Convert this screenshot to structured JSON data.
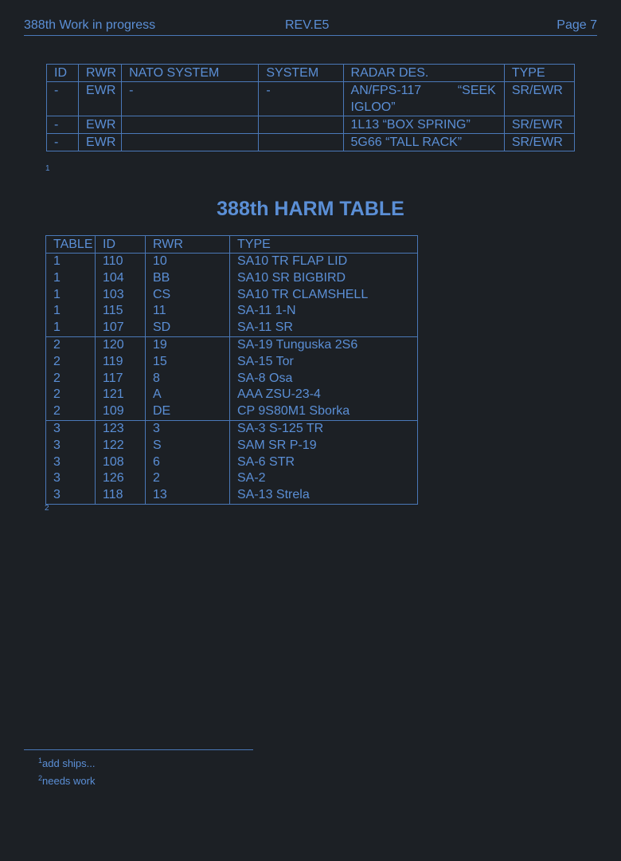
{
  "header": {
    "left": "388th Work in progress",
    "center": "REV.E5",
    "right": "Page 7"
  },
  "radar_table": {
    "headers": [
      "ID",
      "RWR",
      "NATO SYSTEM",
      "SYSTEM",
      "RADAR DES.",
      "TYPE"
    ],
    "rows": [
      [
        "-",
        "EWR",
        "-",
        "-",
        "AN/FPS-117 “SEEK IGLOO”",
        "SR/EWR"
      ],
      [
        "-",
        "EWR",
        "",
        "",
        "1L13 “BOX SPRING”",
        "SR/EWR"
      ],
      [
        "-",
        "EWR",
        "",
        "",
        "5G66 “TALL RACK”",
        "SR/EWR"
      ]
    ],
    "first_des_parts": [
      "AN/FPS-117",
      "“SEEK",
      "IGLOO”"
    ],
    "footnote_ref": "1"
  },
  "harm_title": "388th HARM TABLE",
  "harm_table": {
    "headers": [
      "TABLE",
      "ID",
      "RWR",
      "TYPE"
    ],
    "rows": [
      [
        "1",
        "110",
        "10",
        "SA10 TR FLAP LID"
      ],
      [
        "1",
        "104",
        "BB",
        "SA10 SR BIGBIRD"
      ],
      [
        "1",
        "103",
        "CS",
        "SA10 TR CLAMSHELL"
      ],
      [
        "1",
        "115",
        "11",
        "SA-11 1-N"
      ],
      [
        "1",
        "107",
        "SD",
        "SA-11 SR"
      ],
      [
        "2",
        "120",
        "19",
        "SA-19 Tunguska 2S6"
      ],
      [
        "2",
        "119",
        "15",
        "SA-15 Tor"
      ],
      [
        "2",
        "117",
        "8",
        "SA-8 Osa"
      ],
      [
        "2",
        "121",
        "A",
        "AAA ZSU-23-4"
      ],
      [
        "2",
        "109",
        "DE",
        "CP 9S80M1 Sborka"
      ],
      [
        "3",
        "123",
        "3",
        "SA-3 S-125 TR"
      ],
      [
        "3",
        "122",
        "S",
        "SAM SR P-19"
      ],
      [
        "3",
        "108",
        "6",
        "SA-6 STR"
      ],
      [
        "3",
        "126",
        "2",
        "SA-2"
      ],
      [
        "3",
        "118",
        "13",
        "SA-13 Strela"
      ]
    ],
    "footnote_ref": "2"
  },
  "footnotes": [
    {
      "num": "1",
      "text": "add ships..."
    },
    {
      "num": "2",
      "text": "needs work"
    }
  ]
}
